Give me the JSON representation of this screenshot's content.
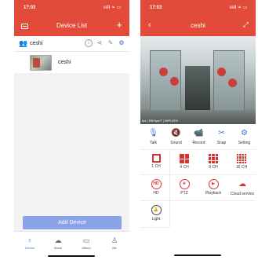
{
  "device_list": {
    "status_time": "17:03",
    "status_signal": "ııll ≈ ▭",
    "title": "Device List",
    "group_name": "ceshi",
    "device_name": "ceshi",
    "add_button": "Add Device",
    "tabs": [
      {
        "label": "Device",
        "icon": "person-pin-icon",
        "active": true
      },
      {
        "label": "Alarm",
        "icon": "cloud-icon",
        "active": false
      },
      {
        "label": "Album",
        "icon": "album-icon",
        "active": false
      },
      {
        "label": "Me",
        "icon": "person-icon",
        "active": false
      }
    ]
  },
  "live_view": {
    "status_time": "17:03",
    "status_signal": "ııll ≈ ▭",
    "title": "ceshi",
    "osd_info": "fps | 59Kbps/T | WiFi:25%",
    "controls_row1": [
      {
        "label": "Talk",
        "icon": "microphone-icon"
      },
      {
        "label": "Sound",
        "icon": "speaker-muted-icon"
      },
      {
        "label": "Record",
        "icon": "video-camera-icon"
      },
      {
        "label": "Snap",
        "icon": "scissors-icon"
      },
      {
        "label": "Setting",
        "icon": "gear-icon"
      }
    ],
    "controls_row2": [
      {
        "label": "1 CH"
      },
      {
        "label": "4 CH"
      },
      {
        "label": "9 CH"
      },
      {
        "label": "16 CH"
      }
    ],
    "controls_row3": [
      {
        "label": "HD",
        "icon_text": "HD"
      },
      {
        "label": "PTZ",
        "icon": "ptz-icon"
      },
      {
        "label": "Playback",
        "icon": "play-icon"
      },
      {
        "label": "Cloud service",
        "icon": "cloud-icon"
      }
    ],
    "controls_row4": [
      {
        "label": "Light",
        "icon": "bell-icon"
      }
    ]
  },
  "colors": {
    "brand": "#e24a3a",
    "accent": "#3b6fd8",
    "button": "#8aa2e8",
    "control_red": "#d9342b"
  }
}
